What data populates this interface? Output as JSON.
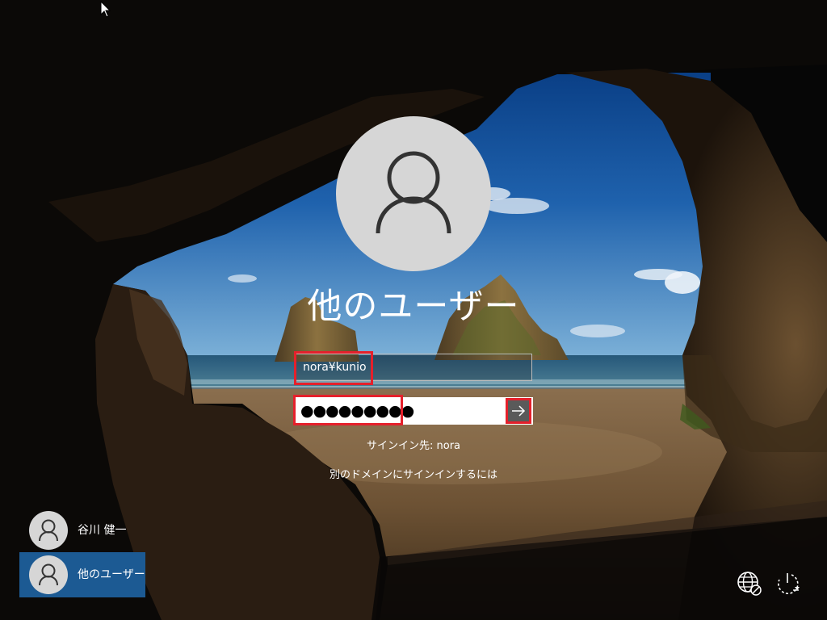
{
  "login": {
    "username_title": "他のユーザー",
    "username_value": "nora¥kunio",
    "password_mask": "●●●●●●●●●",
    "signin_to": "サインイン先: nora",
    "other_domain_link": "別のドメインにサインインするには"
  },
  "user_list": [
    {
      "label": "谷川 健一",
      "selected": false
    },
    {
      "label": "他のユーザー",
      "selected": true
    }
  ],
  "icons": {
    "avatar": "user-silhouette-icon",
    "submit": "arrow-right-icon",
    "network": "network-globe-icon",
    "power": "power-icon",
    "cursor": "mouse-cursor-icon"
  },
  "colors": {
    "highlight_border": "#e5202b",
    "selected_tile": "#1c5a93",
    "avatar_bg": "#d6d6d6"
  }
}
